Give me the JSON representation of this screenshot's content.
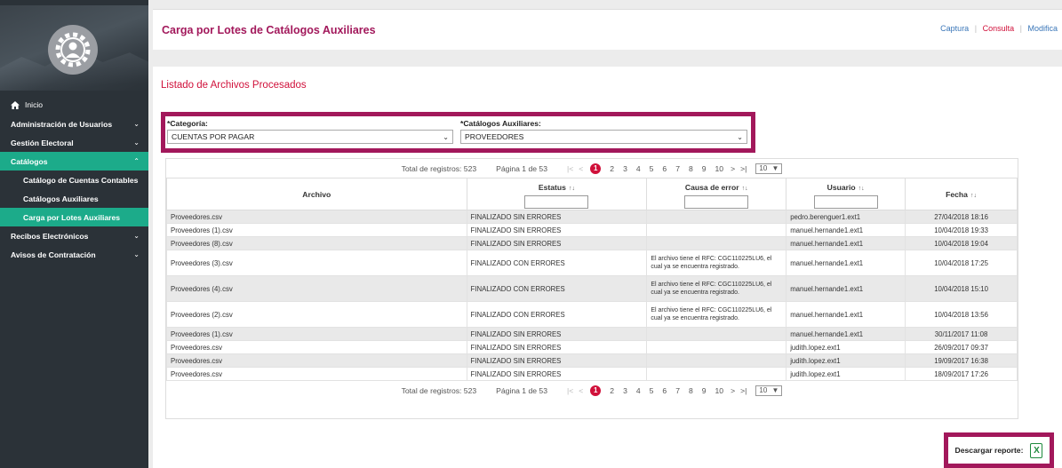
{
  "sidebar": {
    "home_label": "Inicio",
    "items": [
      {
        "label": "Administración de Usuarios"
      },
      {
        "label": "Gestión Electoral"
      },
      {
        "label": "Catálogos"
      },
      {
        "label": "Recibos Electrónicos"
      },
      {
        "label": "Avisos de Contratación"
      }
    ],
    "subitems": [
      {
        "label": "Catálogo de Cuentas Contables"
      },
      {
        "label": "Catálogos Auxiliares"
      },
      {
        "label": "Carga por Lotes Auxiliares"
      }
    ]
  },
  "header": {
    "title": "Carga por Lotes de Catálogos Auxiliares",
    "links": {
      "captura": "Captura",
      "consulta": "Consulta",
      "modifica": "Modifica",
      "separator": "|"
    }
  },
  "main": {
    "section_title": "Listado de Archivos Procesados",
    "filters": {
      "categoria_label": "*Categoría:",
      "categoria_value": "CUENTAS POR PAGAR",
      "catalogos_label": "*Catálogos Auxiliares:",
      "catalogos_value": "PROVEEDORES"
    },
    "pager": {
      "total": "Total de registros: 523",
      "page_info": "Página 1 de 53",
      "first": "|<",
      "prev": "<",
      "next": ">",
      "last": ">|",
      "pages": [
        "1",
        "2",
        "3",
        "4",
        "5",
        "6",
        "7",
        "8",
        "9",
        "10"
      ],
      "page_size": "10"
    },
    "table": {
      "headers": {
        "archivo": "Archivo",
        "estatus": "Estatus",
        "causa": "Causa de error",
        "usuario": "Usuario",
        "fecha": "Fecha"
      },
      "sort_icon": "↑↓",
      "rows": [
        {
          "archivo": "Proveedores.csv",
          "estatus": "FINALIZADO SIN ERRORES",
          "causa": "",
          "usuario": "pedro.berenguer1.ext1",
          "fecha": "27/04/2018 18:16"
        },
        {
          "archivo": "Proveedores (1).csv",
          "estatus": "FINALIZADO SIN ERRORES",
          "causa": "",
          "usuario": "manuel.hernande1.ext1",
          "fecha": "10/04/2018 19:33"
        },
        {
          "archivo": "Proveedores (8).csv",
          "estatus": "FINALIZADO SIN ERRORES",
          "causa": "",
          "usuario": "manuel.hernande1.ext1",
          "fecha": "10/04/2018 19:04"
        },
        {
          "archivo": "Proveedores (3).csv",
          "estatus": "FINALIZADO CON ERRORES",
          "causa": "El archivo tiene el RFC: CGC110225LU6, el cual ya se encuentra registrado.",
          "usuario": "manuel.hernande1.ext1",
          "fecha": "10/04/2018 17:25"
        },
        {
          "archivo": "Proveedores (4).csv",
          "estatus": "FINALIZADO CON ERRORES",
          "causa": "El archivo tiene el RFC: CGC110225LU6, el cual ya se encuentra registrado.",
          "usuario": "manuel.hernande1.ext1",
          "fecha": "10/04/2018 15:10"
        },
        {
          "archivo": "Proveedores (2).csv",
          "estatus": "FINALIZADO CON ERRORES",
          "causa": "El archivo tiene el RFC: CGC110225LU6, el cual ya se encuentra registrado.",
          "usuario": "manuel.hernande1.ext1",
          "fecha": "10/04/2018 13:56"
        },
        {
          "archivo": "Proveedores (1).csv",
          "estatus": "FINALIZADO SIN ERRORES",
          "causa": "",
          "usuario": "manuel.hernande1.ext1",
          "fecha": "30/11/2017 11:08"
        },
        {
          "archivo": "Proveedores.csv",
          "estatus": "FINALIZADO SIN ERRORES",
          "causa": "",
          "usuario": "judith.lopez.ext1",
          "fecha": "26/09/2017 09:37"
        },
        {
          "archivo": "Proveedores.csv",
          "estatus": "FINALIZADO SIN ERRORES",
          "causa": "",
          "usuario": "judith.lopez.ext1",
          "fecha": "19/09/2017 16:38"
        },
        {
          "archivo": "Proveedores.csv",
          "estatus": "FINALIZADO SIN ERRORES",
          "causa": "",
          "usuario": "judith.lopez.ext1",
          "fecha": "18/09/2017 17:26"
        }
      ]
    },
    "download_label": "Descargar reporte:",
    "xls_glyph": "X"
  },
  "colors": {
    "brand": "#a2185b",
    "accent": "#d0103a",
    "active_nav": "#1cab8a",
    "sidebar": "#2b3238"
  },
  "icons": {
    "home": "home-icon",
    "chevron": "chevron-down-icon",
    "excel": "excel-icon"
  }
}
